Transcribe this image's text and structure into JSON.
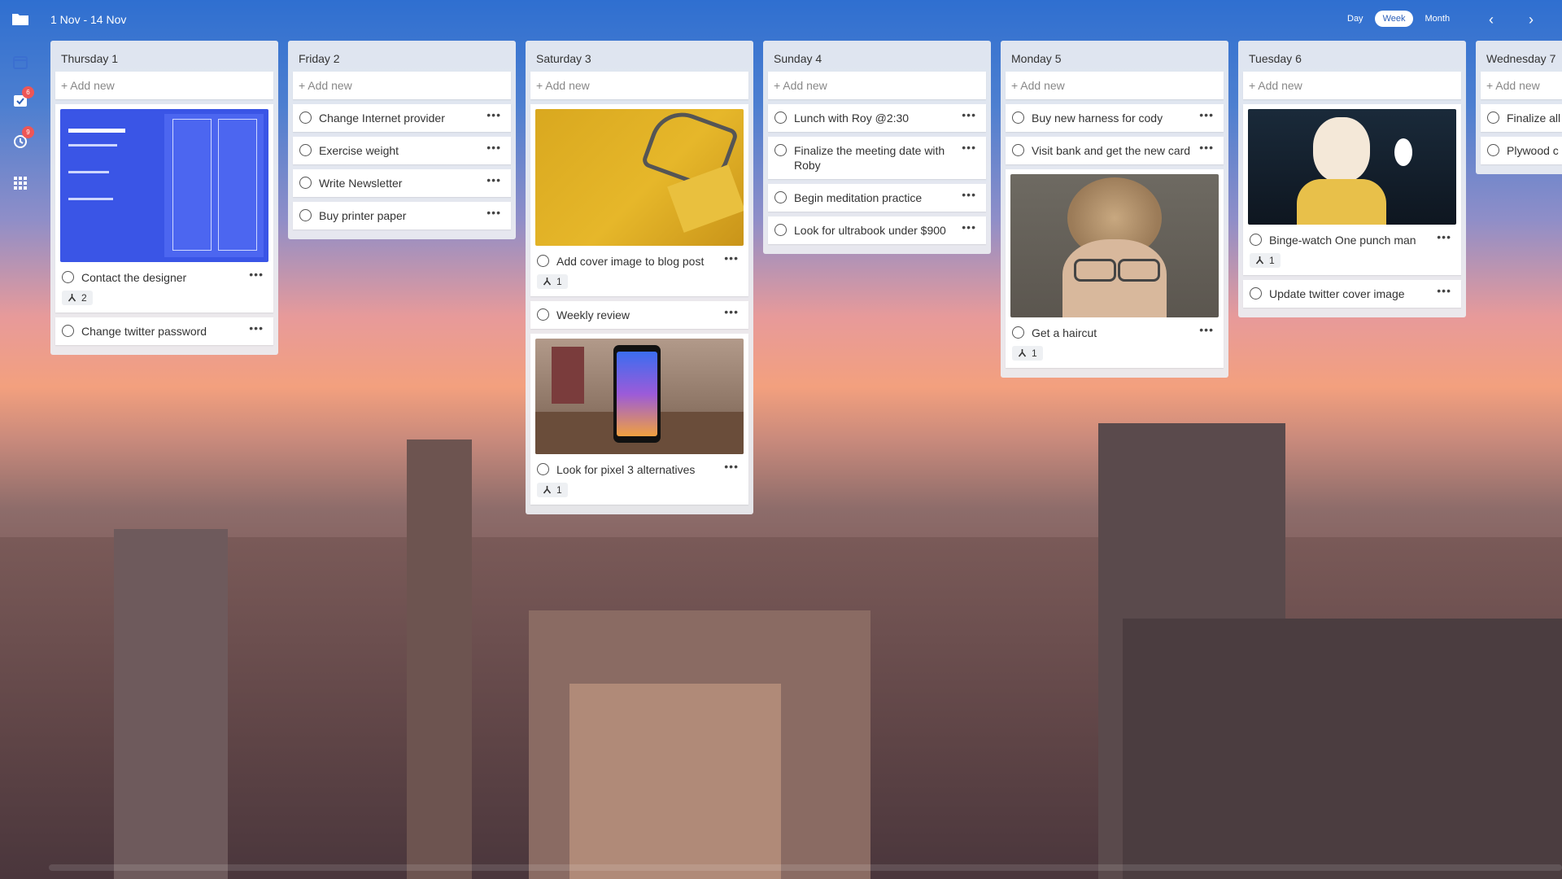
{
  "header": {
    "date_range": "1 Nov - 14 Nov",
    "views": [
      "Day",
      "Week",
      "Month"
    ],
    "active_view": "Week"
  },
  "sidebar": {
    "inbox_badge": "6",
    "history_badge": "9"
  },
  "add_new_label": "+ Add new",
  "columns": [
    {
      "title": "Thursday 1",
      "cards": [
        {
          "title": "Contact the designer",
          "subtasks": "2",
          "image": "wireframe-mockup"
        },
        {
          "title": "Change twitter password"
        }
      ]
    },
    {
      "title": "Friday 2",
      "cards": [
        {
          "title": "Change Internet provider"
        },
        {
          "title": "Exercise weight"
        },
        {
          "title": "Write Newsletter"
        },
        {
          "title": "Buy printer paper"
        }
      ]
    },
    {
      "title": "Saturday 3",
      "cards": [
        {
          "title": "Add cover image to blog post",
          "subtasks": "1",
          "image": "yellow-desk-scissors"
        },
        {
          "title": "Weekly review"
        },
        {
          "title": "Look for pixel 3 alternatives",
          "subtasks": "1",
          "image": "phone-on-table"
        }
      ]
    },
    {
      "title": "Sunday 4",
      "cards": [
        {
          "title": "Lunch with Roy @2:30"
        },
        {
          "title": "Finalize the meeting date with Roby"
        },
        {
          "title": "Begin meditation practice"
        },
        {
          "title": "Look for ultrabook under $900"
        }
      ]
    },
    {
      "title": "Monday 5",
      "cards": [
        {
          "title": "Buy new harness for cody"
        },
        {
          "title": "Visit bank and get the new card"
        },
        {
          "title": "Get a haircut",
          "subtasks": "1",
          "image": "dog-face-kid-photo"
        }
      ]
    },
    {
      "title": "Tuesday 6",
      "cards": [
        {
          "title": "Binge-watch One punch man",
          "subtasks": "1",
          "image": "anime-bald-hero"
        },
        {
          "title": "Update twitter cover image"
        }
      ]
    },
    {
      "title": "Wednesday 7",
      "cards": [
        {
          "title": "Finalize all"
        },
        {
          "title": "Plywood c"
        }
      ]
    }
  ],
  "colors": {
    "accent": "#2c5fb8",
    "badge": "#ee5656",
    "column_bg": "#eceef2"
  }
}
